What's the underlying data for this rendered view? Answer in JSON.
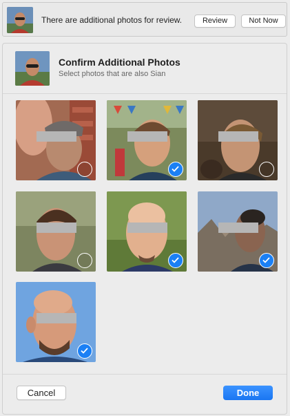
{
  "banner": {
    "thumb_icon": "person-thumbnail",
    "text": "There are additional photos for review.",
    "review_label": "Review",
    "not_now_label": "Not Now"
  },
  "dialog": {
    "title": "Confirm Additional Photos",
    "subtitle": "Select photos that are also Sian",
    "header_thumb_icon": "person-thumbnail",
    "photos": [
      {
        "selected": false
      },
      {
        "selected": true
      },
      {
        "selected": false
      },
      {
        "selected": false
      },
      {
        "selected": true
      },
      {
        "selected": true
      },
      {
        "selected": true
      }
    ],
    "cancel_label": "Cancel",
    "done_label": "Done"
  },
  "colors": {
    "accent": "#1b80f5",
    "redaction": "#b6b6b6",
    "background": "#ececec"
  }
}
